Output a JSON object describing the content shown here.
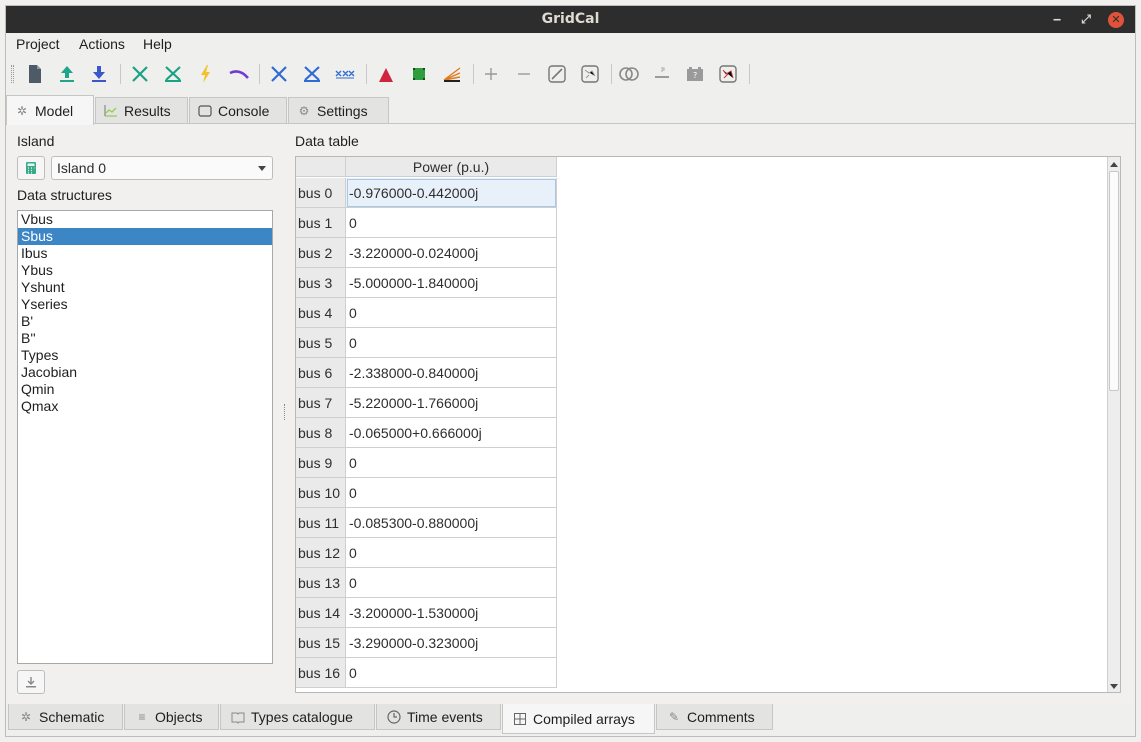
{
  "window": {
    "title": "GridCal"
  },
  "menu": [
    "Project",
    "Actions",
    "Help"
  ],
  "toolbar_icons": [
    "new-file-icon",
    "open-icon",
    "save-icon",
    "power-flow-icon",
    "short-circuit-icon",
    "lightning-icon",
    "voltage-stability-icon",
    "cross-icon",
    "cross-grid-icon",
    "multi-cross-icon",
    "peak-icon",
    "grid-square-icon",
    "chart-lines-icon",
    "plus-icon",
    "minus-icon",
    "line-icon",
    "map-icon",
    "rings-icon",
    "dash-icon",
    "battery-icon",
    "scatter-map-icon"
  ],
  "top_tabs": [
    {
      "label": "Model",
      "icon": "atom-icon"
    },
    {
      "label": "Results",
      "icon": "chart-icon"
    },
    {
      "label": "Console",
      "icon": "console-icon"
    },
    {
      "label": "Settings",
      "icon": "gear-icon"
    }
  ],
  "left": {
    "island_label": "Island",
    "island_value": "Island 0",
    "structures_label": "Data structures",
    "structures": [
      "Vbus",
      "Sbus",
      "Ibus",
      "Ybus",
      "Yshunt",
      "Yseries",
      "B'",
      "B''",
      "Types",
      "Jacobian",
      "Qmin",
      "Qmax"
    ],
    "selected_index": 1
  },
  "table": {
    "label": "Data table",
    "column": "Power (p.u.)",
    "rows": [
      {
        "bus": "bus 0",
        "value": "-0.976000-0.442000j"
      },
      {
        "bus": "bus 1",
        "value": "0"
      },
      {
        "bus": "bus 2",
        "value": "-3.220000-0.024000j"
      },
      {
        "bus": "bus 3",
        "value": "-5.000000-1.840000j"
      },
      {
        "bus": "bus 4",
        "value": "0"
      },
      {
        "bus": "bus 5",
        "value": "0"
      },
      {
        "bus": "bus 6",
        "value": "-2.338000-0.840000j"
      },
      {
        "bus": "bus 7",
        "value": "-5.220000-1.766000j"
      },
      {
        "bus": "bus 8",
        "value": "-0.065000+0.666000j"
      },
      {
        "bus": "bus 9",
        "value": "0"
      },
      {
        "bus": "bus 10",
        "value": "0"
      },
      {
        "bus": "bus 11",
        "value": "-0.085300-0.880000j"
      },
      {
        "bus": "bus 12",
        "value": "0"
      },
      {
        "bus": "bus 13",
        "value": "0"
      },
      {
        "bus": "bus 14",
        "value": "-3.200000-1.530000j"
      },
      {
        "bus": "bus 15",
        "value": "-3.290000-0.323000j"
      },
      {
        "bus": "bus 16",
        "value": "0"
      }
    ]
  },
  "bottom_tabs": [
    {
      "label": "Schematic",
      "icon": "atom-icon"
    },
    {
      "label": "Objects",
      "icon": "list-icon"
    },
    {
      "label": "Types catalogue",
      "icon": "book-icon"
    },
    {
      "label": "Time events",
      "icon": "clock-icon"
    },
    {
      "label": "Compiled arrays",
      "icon": "grid-icon"
    },
    {
      "label": "Comments",
      "icon": "pencil-icon"
    }
  ],
  "colors": {
    "selection": "#3d86c6",
    "titlebar": "#2d2d2d",
    "close": "#e0533a"
  }
}
